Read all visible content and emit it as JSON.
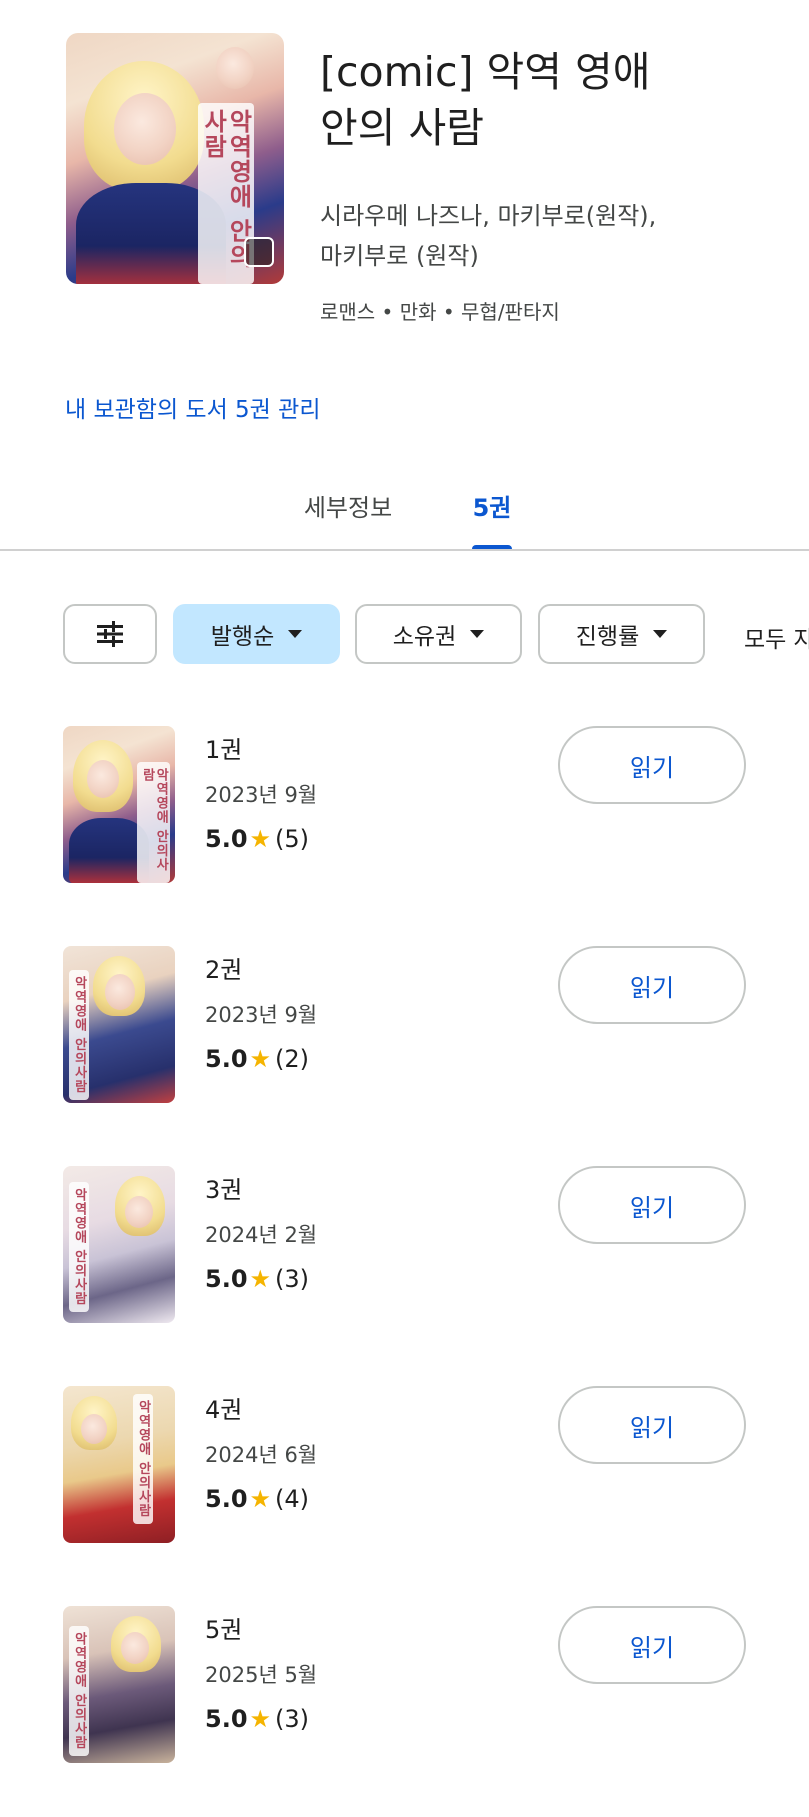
{
  "book": {
    "title_line1": "[comic] 악역 영애",
    "title_line2": "안의 사람",
    "authors_line1": "시라우메 나즈나, 마키부로(원작),",
    "authors_line2": "마키부로 (원작)",
    "genres": "로맨스 • 만화 • 무협/판타지",
    "cover_text": "악역영애 안의사람"
  },
  "library_link": "내 보관함의 도서 5권 관리",
  "tabs": [
    {
      "label": "세부정보",
      "active": false
    },
    {
      "label": "5권",
      "active": true
    }
  ],
  "filters": {
    "icon": "tune-icon",
    "chips": [
      {
        "label": "발행순",
        "selected": true
      },
      {
        "label": "소유권",
        "selected": false
      },
      {
        "label": "진행률",
        "selected": false
      }
    ],
    "overflow_label": "모두 자"
  },
  "volumes": [
    {
      "label": "1권",
      "date": "2023년 9월",
      "score": "5.0",
      "count": "(5)",
      "button": "읽기"
    },
    {
      "label": "2권",
      "date": "2023년 9월",
      "score": "5.0",
      "count": "(2)",
      "button": "읽기"
    },
    {
      "label": "3권",
      "date": "2024년 2월",
      "score": "5.0",
      "count": "(3)",
      "button": "읽기"
    },
    {
      "label": "4권",
      "date": "2024년 6월",
      "score": "5.0",
      "count": "(4)",
      "button": "읽기"
    },
    {
      "label": "5권",
      "date": "2025년 5월",
      "score": "5.0",
      "count": "(3)",
      "button": "읽기"
    }
  ],
  "colors": {
    "accent": "#0b57d0",
    "selected_chip": "#c2e7ff",
    "star": "#f5b400",
    "divider": "#d0d0d0"
  }
}
